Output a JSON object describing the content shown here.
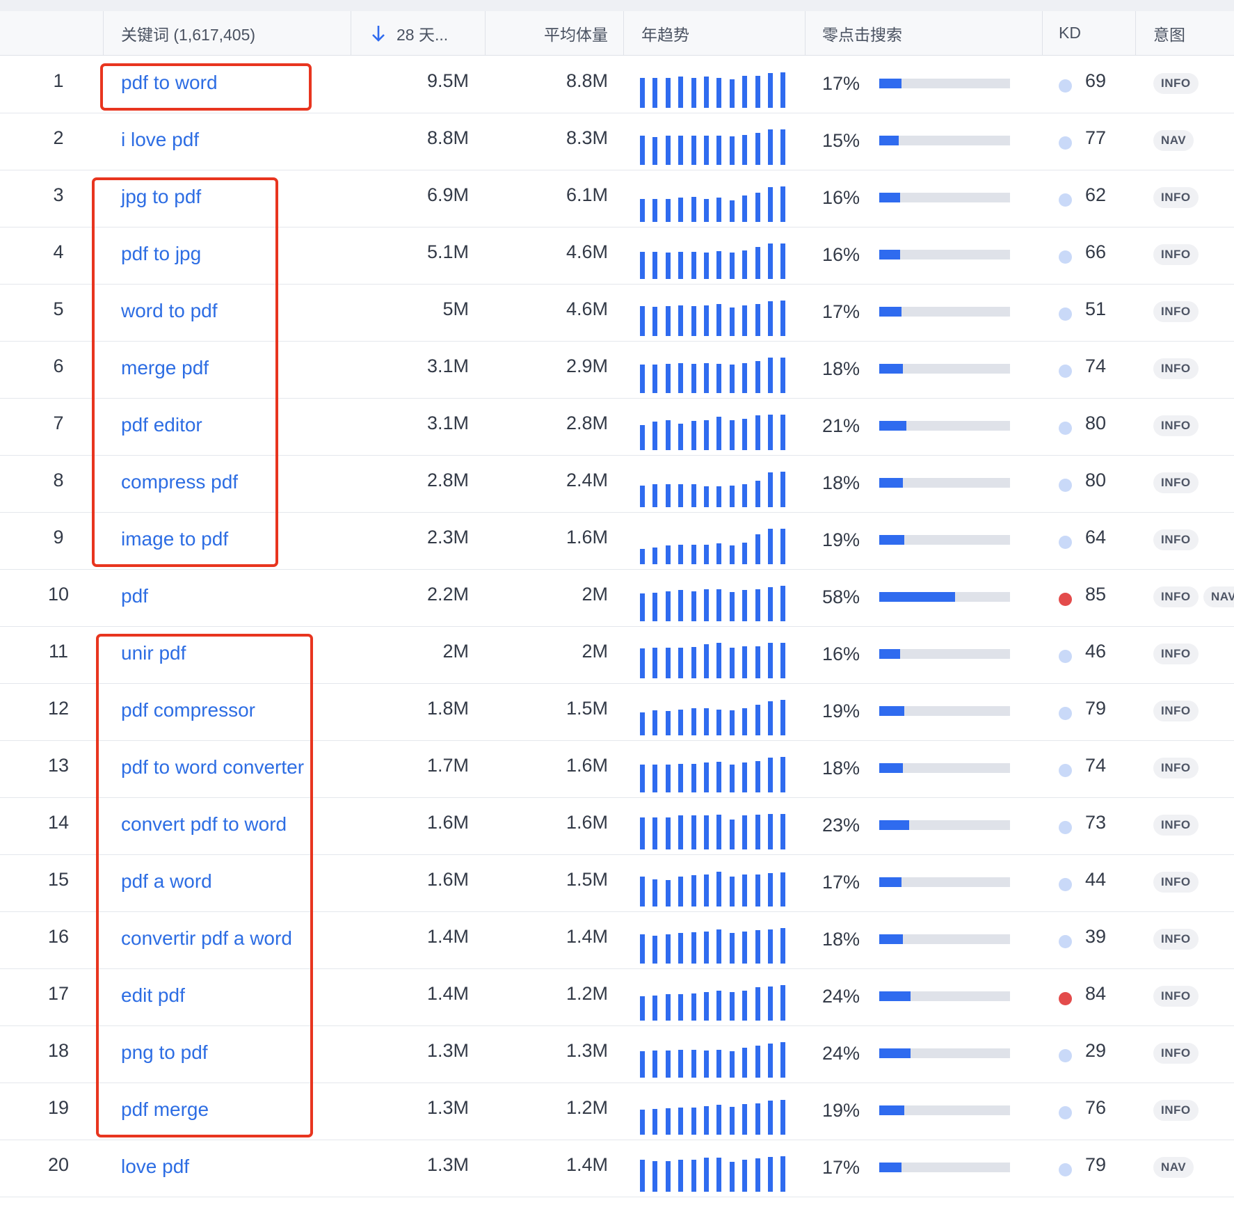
{
  "header": {
    "keyword_label": "关键词 (1,617,405)",
    "days_label": "28 天...",
    "avg_label": "平均体量",
    "trend_label": "年趋势",
    "zero_click_label": "零点击搜索",
    "kd_label": "KD",
    "intent_label": "意图"
  },
  "colors": {
    "accent": "#2f6bef",
    "link": "#2d6de3",
    "kd_low": "#c9d9f8",
    "kd_high": "#e34b4b",
    "highlight": "#e8351f"
  },
  "rows": [
    {
      "num": "1",
      "keyword": "pdf to word",
      "volume": "9.5M",
      "avg": "8.8M",
      "trend": [
        0.8,
        0.8,
        0.8,
        0.84,
        0.8,
        0.84,
        0.8,
        0.76,
        0.85,
        0.85,
        0.92,
        0.94
      ],
      "zero_pct": "17%",
      "zero_val": 0.17,
      "kd": "69",
      "kd_level": "low",
      "intents": [
        "INFO"
      ]
    },
    {
      "num": "2",
      "keyword": "i love pdf",
      "volume": "8.8M",
      "avg": "8.3M",
      "trend": [
        0.78,
        0.75,
        0.78,
        0.78,
        0.78,
        0.78,
        0.78,
        0.76,
        0.8,
        0.85,
        0.94,
        0.94
      ],
      "zero_pct": "15%",
      "zero_val": 0.15,
      "kd": "77",
      "kd_level": "low",
      "intents": [
        "NAV"
      ]
    },
    {
      "num": "3",
      "keyword": "jpg to pdf",
      "volume": "6.9M",
      "avg": "6.1M",
      "trend": [
        0.62,
        0.62,
        0.62,
        0.65,
        0.66,
        0.62,
        0.65,
        0.57,
        0.7,
        0.78,
        0.92,
        0.94
      ],
      "zero_pct": "16%",
      "zero_val": 0.16,
      "kd": "62",
      "kd_level": "low",
      "intents": [
        "INFO"
      ]
    },
    {
      "num": "4",
      "keyword": "pdf to jpg",
      "volume": "5.1M",
      "avg": "4.6M",
      "trend": [
        0.72,
        0.72,
        0.7,
        0.72,
        0.72,
        0.7,
        0.74,
        0.7,
        0.76,
        0.85,
        0.94,
        0.94
      ],
      "zero_pct": "16%",
      "zero_val": 0.16,
      "kd": "66",
      "kd_level": "low",
      "intents": [
        "INFO"
      ]
    },
    {
      "num": "5",
      "keyword": "word to pdf",
      "volume": "5M",
      "avg": "4.6M",
      "trend": [
        0.8,
        0.78,
        0.8,
        0.82,
        0.8,
        0.82,
        0.86,
        0.76,
        0.82,
        0.86,
        0.92,
        0.94
      ],
      "zero_pct": "17%",
      "zero_val": 0.17,
      "kd": "51",
      "kd_level": "low",
      "intents": [
        "INFO"
      ]
    },
    {
      "num": "6",
      "keyword": "merge pdf",
      "volume": "3.1M",
      "avg": "2.9M",
      "trend": [
        0.76,
        0.76,
        0.78,
        0.8,
        0.78,
        0.8,
        0.78,
        0.76,
        0.8,
        0.86,
        0.94,
        0.94
      ],
      "zero_pct": "18%",
      "zero_val": 0.18,
      "kd": "74",
      "kd_level": "low",
      "intents": [
        "INFO"
      ]
    },
    {
      "num": "7",
      "keyword": "pdf editor",
      "volume": "3.1M",
      "avg": "2.8M",
      "trend": [
        0.66,
        0.76,
        0.8,
        0.7,
        0.78,
        0.8,
        0.88,
        0.8,
        0.84,
        0.92,
        0.94,
        0.94
      ],
      "zero_pct": "21%",
      "zero_val": 0.21,
      "kd": "80",
      "kd_level": "low",
      "intents": [
        "INFO"
      ]
    },
    {
      "num": "8",
      "keyword": "compress pdf",
      "volume": "2.8M",
      "avg": "2.4M",
      "trend": [
        0.58,
        0.62,
        0.62,
        0.62,
        0.62,
        0.56,
        0.56,
        0.58,
        0.62,
        0.7,
        0.92,
        0.94
      ],
      "zero_pct": "18%",
      "zero_val": 0.18,
      "kd": "80",
      "kd_level": "low",
      "intents": [
        "INFO"
      ]
    },
    {
      "num": "9",
      "keyword": "image to pdf",
      "volume": "2.3M",
      "avg": "1.6M",
      "trend": [
        0.4,
        0.44,
        0.5,
        0.52,
        0.52,
        0.52,
        0.56,
        0.5,
        0.58,
        0.8,
        0.94,
        0.94
      ],
      "zero_pct": "19%",
      "zero_val": 0.19,
      "kd": "64",
      "kd_level": "low",
      "intents": [
        "INFO"
      ]
    },
    {
      "num": "10",
      "keyword": "pdf",
      "volume": "2.2M",
      "avg": "2M",
      "trend": [
        0.74,
        0.76,
        0.8,
        0.84,
        0.8,
        0.86,
        0.86,
        0.78,
        0.84,
        0.86,
        0.9,
        0.94
      ],
      "zero_pct": "58%",
      "zero_val": 0.58,
      "kd": "85",
      "kd_level": "high",
      "intents": [
        "INFO",
        "NAV"
      ]
    },
    {
      "num": "11",
      "keyword": "unir pdf",
      "volume": "2M",
      "avg": "2M",
      "trend": [
        0.8,
        0.82,
        0.82,
        0.82,
        0.84,
        0.9,
        0.94,
        0.82,
        0.86,
        0.86,
        0.94,
        0.94
      ],
      "zero_pct": "16%",
      "zero_val": 0.16,
      "kd": "46",
      "kd_level": "low",
      "intents": [
        "INFO"
      ]
    },
    {
      "num": "12",
      "keyword": "pdf compressor",
      "volume": "1.8M",
      "avg": "1.5M",
      "trend": [
        0.62,
        0.66,
        0.64,
        0.68,
        0.72,
        0.72,
        0.68,
        0.66,
        0.72,
        0.82,
        0.9,
        0.94
      ],
      "zero_pct": "19%",
      "zero_val": 0.19,
      "kd": "79",
      "kd_level": "low",
      "intents": [
        "INFO"
      ]
    },
    {
      "num": "13",
      "keyword": "pdf to word converter",
      "volume": "1.7M",
      "avg": "1.6M",
      "trend": [
        0.74,
        0.74,
        0.74,
        0.76,
        0.76,
        0.8,
        0.82,
        0.74,
        0.8,
        0.84,
        0.92,
        0.94
      ],
      "zero_pct": "18%",
      "zero_val": 0.18,
      "kd": "74",
      "kd_level": "low",
      "intents": [
        "INFO"
      ]
    },
    {
      "num": "14",
      "keyword": "convert pdf to word",
      "volume": "1.6M",
      "avg": "1.6M",
      "trend": [
        0.86,
        0.86,
        0.86,
        0.9,
        0.9,
        0.9,
        0.92,
        0.8,
        0.9,
        0.92,
        0.94,
        0.94
      ],
      "zero_pct": "23%",
      "zero_val": 0.23,
      "kd": "73",
      "kd_level": "low",
      "intents": [
        "INFO"
      ]
    },
    {
      "num": "15",
      "keyword": "pdf a word",
      "volume": "1.6M",
      "avg": "1.5M",
      "trend": [
        0.8,
        0.72,
        0.7,
        0.8,
        0.84,
        0.86,
        0.92,
        0.8,
        0.86,
        0.86,
        0.88,
        0.9
      ],
      "zero_pct": "17%",
      "zero_val": 0.17,
      "kd": "44",
      "kd_level": "low",
      "intents": [
        "INFO"
      ]
    },
    {
      "num": "16",
      "keyword": "convertir pdf a word",
      "volume": "1.4M",
      "avg": "1.4M",
      "trend": [
        0.78,
        0.74,
        0.78,
        0.82,
        0.84,
        0.86,
        0.9,
        0.82,
        0.86,
        0.88,
        0.9,
        0.94
      ],
      "zero_pct": "18%",
      "zero_val": 0.18,
      "kd": "39",
      "kd_level": "low",
      "intents": [
        "INFO"
      ]
    },
    {
      "num": "17",
      "keyword": "edit pdf",
      "volume": "1.4M",
      "avg": "1.2M",
      "trend": [
        0.64,
        0.66,
        0.7,
        0.7,
        0.72,
        0.76,
        0.8,
        0.76,
        0.8,
        0.88,
        0.9,
        0.94
      ],
      "zero_pct": "24%",
      "zero_val": 0.24,
      "kd": "84",
      "kd_level": "high",
      "intents": [
        "INFO"
      ]
    },
    {
      "num": "18",
      "keyword": "png to pdf",
      "volume": "1.3M",
      "avg": "1.3M",
      "trend": [
        0.7,
        0.72,
        0.72,
        0.74,
        0.74,
        0.72,
        0.74,
        0.7,
        0.8,
        0.86,
        0.9,
        0.94
      ],
      "zero_pct": "24%",
      "zero_val": 0.24,
      "kd": "29",
      "kd_level": "low",
      "intents": [
        "INFO"
      ]
    },
    {
      "num": "19",
      "keyword": "pdf merge",
      "volume": "1.3M",
      "avg": "1.2M",
      "trend": [
        0.66,
        0.68,
        0.7,
        0.72,
        0.72,
        0.76,
        0.8,
        0.74,
        0.82,
        0.84,
        0.9,
        0.92
      ],
      "zero_pct": "19%",
      "zero_val": 0.19,
      "kd": "76",
      "kd_level": "low",
      "intents": [
        "INFO"
      ]
    },
    {
      "num": "20",
      "keyword": "love pdf",
      "volume": "1.3M",
      "avg": "1.4M",
      "trend": [
        0.86,
        0.82,
        0.82,
        0.86,
        0.86,
        0.9,
        0.9,
        0.8,
        0.86,
        0.88,
        0.92,
        0.94
      ],
      "zero_pct": "17%",
      "zero_val": 0.17,
      "kd": "79",
      "kd_level": "low",
      "intents": [
        "NAV"
      ]
    }
  ],
  "highlight_groups": [
    {
      "from_row": 1,
      "to_row": 1
    },
    {
      "from_row": 3,
      "to_row": 9
    },
    {
      "from_row": 11,
      "to_row": 19
    }
  ]
}
